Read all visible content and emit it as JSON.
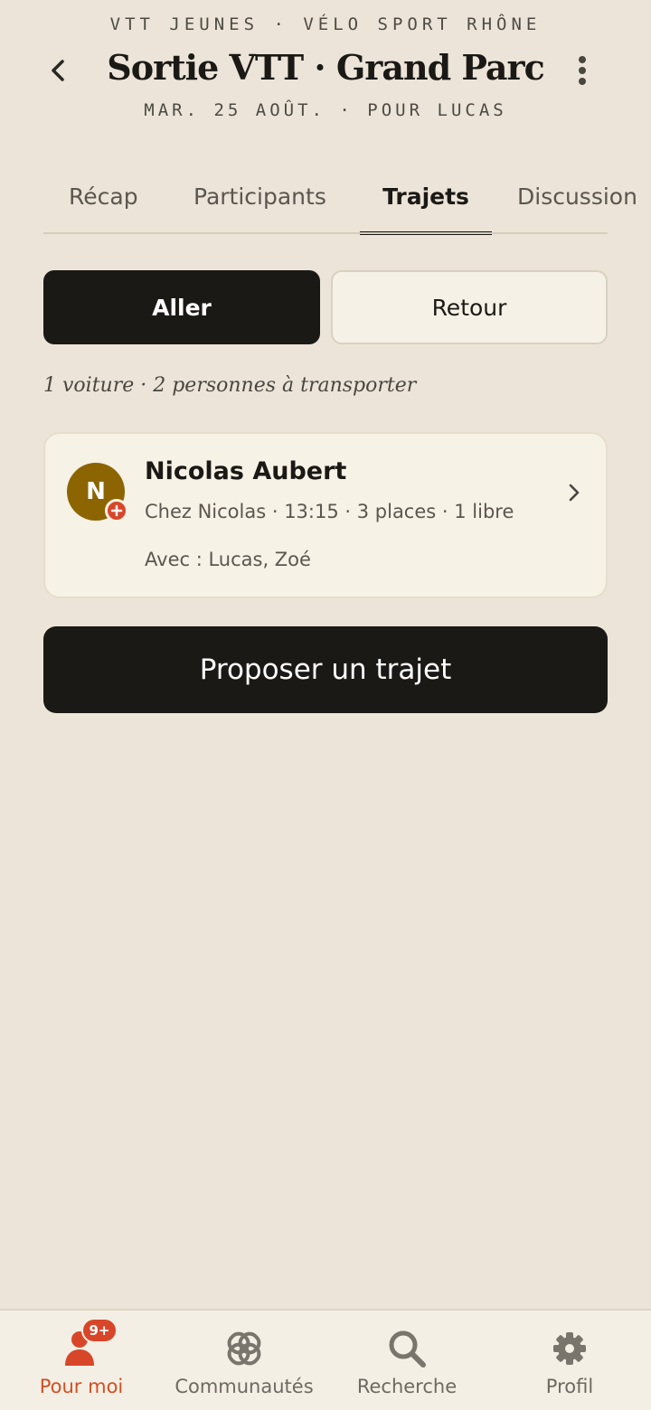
{
  "header": {
    "group": "VTT JEUNES · VÉLO SPORT RHÔNE",
    "title": "Sortie VTT · Grand Parc",
    "subtitle": "MAR. 25 AOÛT. · POUR LUCAS"
  },
  "tabs": [
    {
      "label": "Récap",
      "active": false
    },
    {
      "label": "Participants",
      "active": false
    },
    {
      "label": "Trajets",
      "active": true
    },
    {
      "label": "Discussion",
      "active": false
    }
  ],
  "segment": {
    "aller": "Aller",
    "retour": "Retour",
    "selected": "Aller"
  },
  "summary": "1 voiture · 2 personnes à transporter",
  "ride": {
    "avatar_initial": "N",
    "driver": "Nicolas Aubert",
    "details": "Chez Nicolas · 13:15 · 3 places · 1 libre",
    "passengers": "Avec : Lucas, Zoé"
  },
  "cta": "Proposer un trajet",
  "nav": {
    "items": [
      {
        "label": "Pour moi",
        "icon": "person-icon",
        "badge": "9+",
        "active": true
      },
      {
        "label": "Communautés",
        "icon": "communities-icon",
        "active": false
      },
      {
        "label": "Recherche",
        "icon": "search-icon",
        "active": false
      },
      {
        "label": "Profil",
        "icon": "gear-icon",
        "active": false
      }
    ]
  },
  "colors": {
    "background": "#ECE4D8",
    "primary": "#1B1915",
    "accent": "#D24E24",
    "avatar": "#8C6500"
  }
}
